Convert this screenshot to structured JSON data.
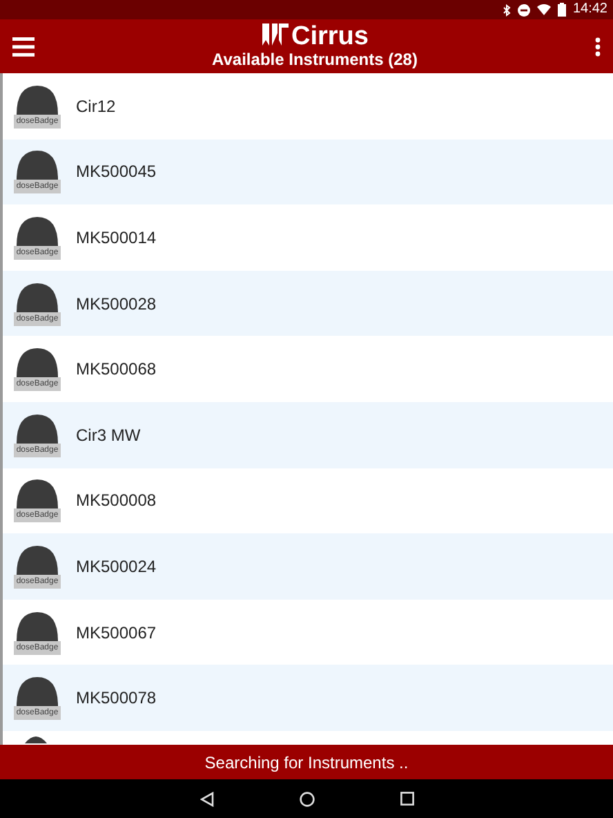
{
  "status_bar": {
    "time": "14:42"
  },
  "app_bar": {
    "logo": "Cirrus",
    "title": "Available Instruments (28)"
  },
  "instruments": [
    {
      "name": "Cir12",
      "badge_label": "doseBadge"
    },
    {
      "name": "MK500045",
      "badge_label": "doseBadge"
    },
    {
      "name": "MK500014",
      "badge_label": "doseBadge"
    },
    {
      "name": "MK500028",
      "badge_label": "doseBadge"
    },
    {
      "name": "MK500068",
      "badge_label": "doseBadge"
    },
    {
      "name": "Cir3 MW",
      "badge_label": "doseBadge"
    },
    {
      "name": "MK500008",
      "badge_label": "doseBadge"
    },
    {
      "name": "MK500024",
      "badge_label": "doseBadge"
    },
    {
      "name": "MK500067",
      "badge_label": "doseBadge"
    },
    {
      "name": "MK500078",
      "badge_label": "doseBadge"
    }
  ],
  "footer": {
    "message": "Searching for Instruments .."
  }
}
